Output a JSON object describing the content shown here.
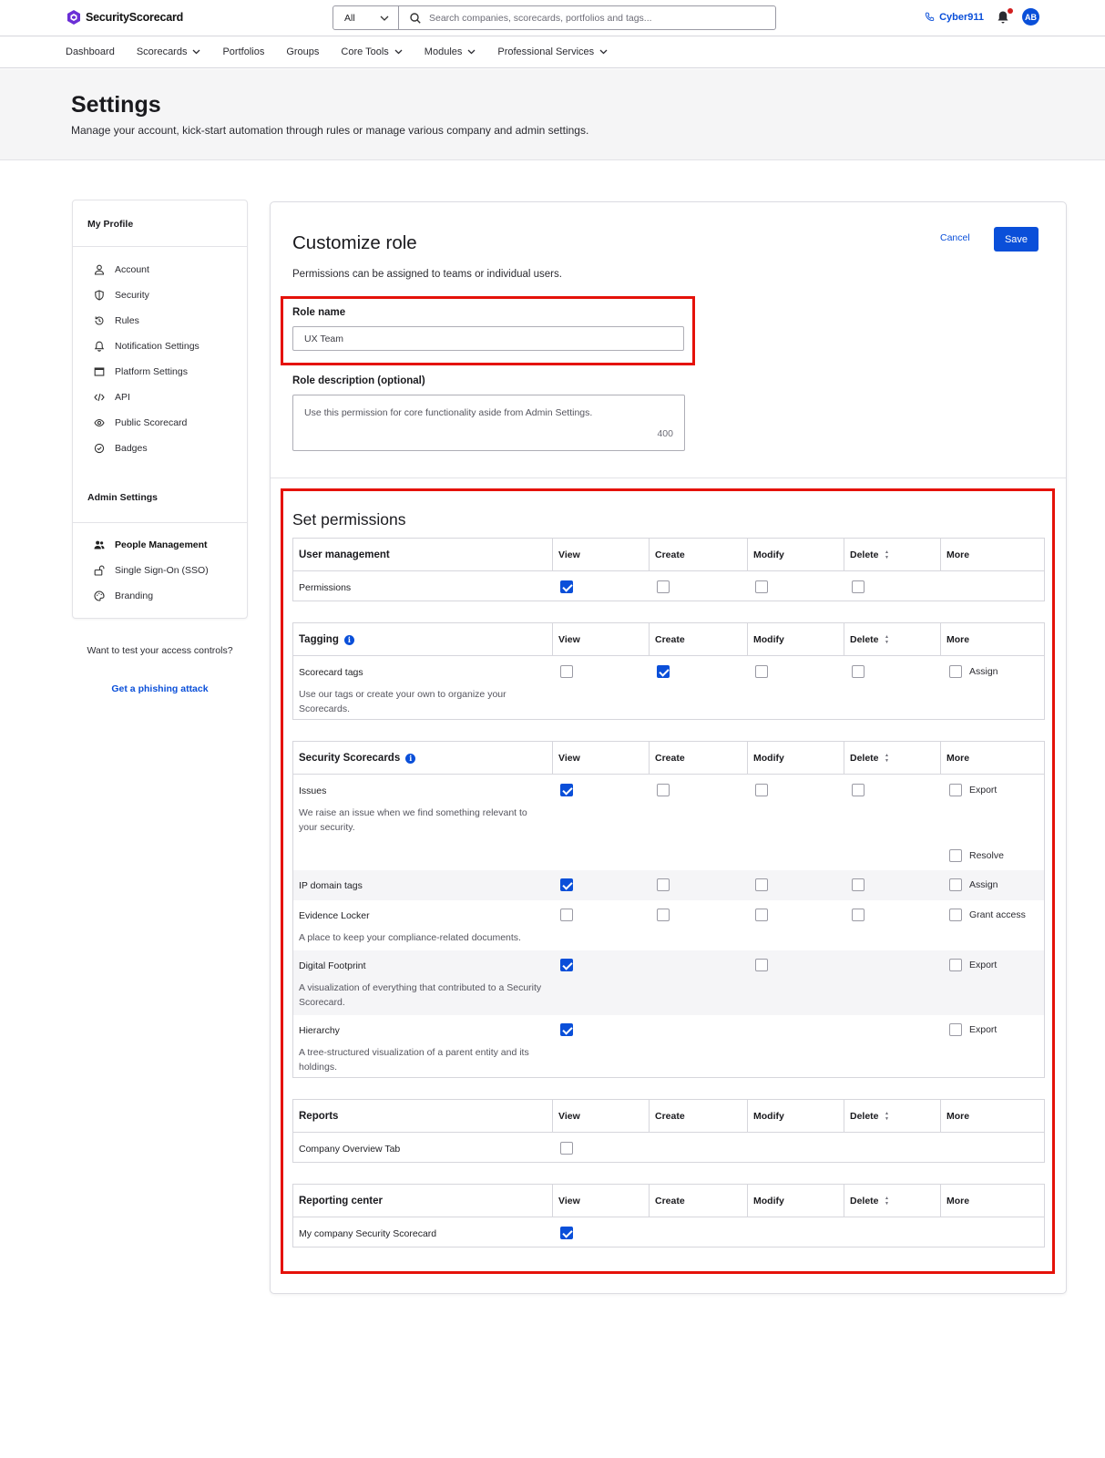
{
  "header": {
    "logo_text": "SecurityScorecard",
    "search_scope": "All",
    "search_placeholder": "Search companies, scorecards, portfolios and tags...",
    "user_link": "Cyber911",
    "avatar_initials": "AB"
  },
  "nav": {
    "items": [
      {
        "label": "Dashboard",
        "dropdown": false
      },
      {
        "label": "Scorecards",
        "dropdown": true
      },
      {
        "label": "Portfolios",
        "dropdown": false
      },
      {
        "label": "Groups",
        "dropdown": false
      },
      {
        "label": "Core Tools",
        "dropdown": true
      },
      {
        "label": "Modules",
        "dropdown": true
      },
      {
        "label": "Professional Services",
        "dropdown": true
      }
    ]
  },
  "page": {
    "title": "Settings",
    "subtitle": "Manage your account, kick-start automation through rules or manage various company and admin settings."
  },
  "sidebar": {
    "profile_heading": "My Profile",
    "profile_items": [
      "Account",
      "Security",
      "Rules",
      "Notification Settings",
      "Platform Settings",
      "API",
      "Public Scorecard",
      "Badges"
    ],
    "admin_heading": "Admin Settings",
    "admin_items": [
      "People Management",
      "Single Sign-On (SSO)",
      "Branding"
    ],
    "phishing_question": "Want to test your access controls?",
    "phishing_link": "Get a phishing attack"
  },
  "role": {
    "title": "Customize role",
    "subtitle": "Permissions can be assigned to teams or individual users.",
    "cancel": "Cancel",
    "save": "Save",
    "name_label": "Role name",
    "name_value": "UX Team",
    "desc_label": "Role description (optional)",
    "desc_value": "Use this permission for core functionality aside from Admin Settings.",
    "desc_count": "400"
  },
  "permissions": {
    "title": "Set permissions",
    "columns": [
      "View",
      "Create",
      "Modify",
      "Delete",
      "More"
    ],
    "accent_color": "#0a4fd9",
    "highlight_color": "#e5120a",
    "tables": [
      {
        "heading": "User management",
        "info": false,
        "rows": [
          {
            "name": "Permissions",
            "desc": "",
            "view": true,
            "create": false,
            "modify": false,
            "delete": false,
            "more": []
          }
        ]
      },
      {
        "heading": "Tagging",
        "info": true,
        "rows": [
          {
            "name": "Scorecard tags",
            "desc": "Use our tags or create your own to organize your Scorecards.",
            "view": false,
            "create": true,
            "modify": false,
            "delete": false,
            "more": [
              "Assign"
            ]
          }
        ]
      },
      {
        "heading": "Security Scorecards",
        "info": true,
        "rows": [
          {
            "name": "Issues",
            "desc": "We raise an issue when we find something relevant to your security.",
            "view": true,
            "create": false,
            "modify": false,
            "delete": false,
            "more": [
              "Export",
              "Resolve"
            ]
          },
          {
            "name": "IP domain tags",
            "desc": "",
            "view": true,
            "create": false,
            "modify": false,
            "delete": false,
            "more": [
              "Assign"
            ]
          },
          {
            "name": "Evidence Locker",
            "desc": "A place to keep your compliance-related documents.",
            "view": false,
            "create": false,
            "modify": false,
            "delete": false,
            "more": [
              "Grant access"
            ]
          },
          {
            "name": "Digital Footprint",
            "desc": "A visualization of everything that contributed to a Security Scorecard.",
            "view": true,
            "create": null,
            "modify": false,
            "delete": null,
            "more": [
              "Export"
            ]
          },
          {
            "name": "Hierarchy",
            "desc": "A tree-structured visualization of a parent entity and its holdings.",
            "view": true,
            "create": null,
            "modify": null,
            "delete": null,
            "more": [
              "Export"
            ]
          }
        ]
      },
      {
        "heading": "Reports",
        "info": false,
        "rows": [
          {
            "name": "Company Overview Tab",
            "desc": "",
            "view": false,
            "create": null,
            "modify": null,
            "delete": null,
            "more": []
          }
        ]
      },
      {
        "heading": "Reporting center",
        "info": false,
        "rows": [
          {
            "name": "My company Security Scorecard",
            "desc": "",
            "view": true,
            "create": null,
            "modify": null,
            "delete": null,
            "more": []
          }
        ]
      }
    ]
  }
}
